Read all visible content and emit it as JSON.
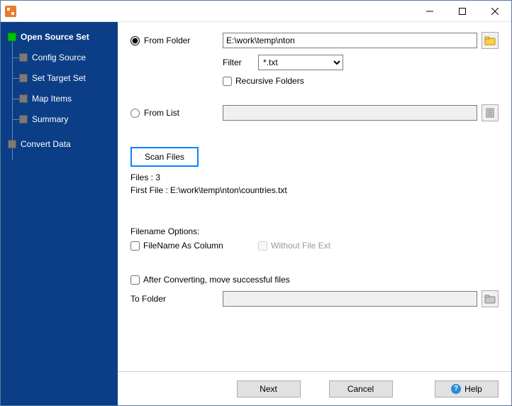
{
  "sidebar": {
    "items": [
      {
        "label": "Open Source Set",
        "active": true,
        "level": 0
      },
      {
        "label": "Config Source",
        "active": false,
        "level": 1
      },
      {
        "label": "Set Target Set",
        "active": false,
        "level": 1
      },
      {
        "label": "Map Items",
        "active": false,
        "level": 1
      },
      {
        "label": "Summary",
        "active": false,
        "level": 1
      },
      {
        "label": "Convert Data",
        "active": false,
        "level": 0
      }
    ]
  },
  "source": {
    "from_folder_label": "From Folder",
    "folder_path": "E:\\work\\temp\\nton",
    "filter_label": "Filter",
    "filter_value": "*.txt",
    "recursive_label": "Recursive Folders",
    "from_list_label": "From List",
    "from_list_value": ""
  },
  "scan": {
    "button_label": "Scan Files",
    "files_label": "Files : 3",
    "first_file_label": "First File : E:\\work\\temp\\nton\\countries.txt"
  },
  "filename_options": {
    "heading": "Filename Options:",
    "as_column_label": "FileName As Column",
    "without_ext_label": "Without File Ext"
  },
  "after": {
    "move_label": "After Converting, move successful files",
    "to_folder_label": "To Folder",
    "to_folder_value": ""
  },
  "footer": {
    "next": "Next",
    "cancel": "Cancel",
    "help": "Help"
  },
  "icons": {
    "browse_folder": "browse-folder-icon",
    "browse_list": "browse-list-icon",
    "browse_dest": "browse-dest-icon"
  }
}
